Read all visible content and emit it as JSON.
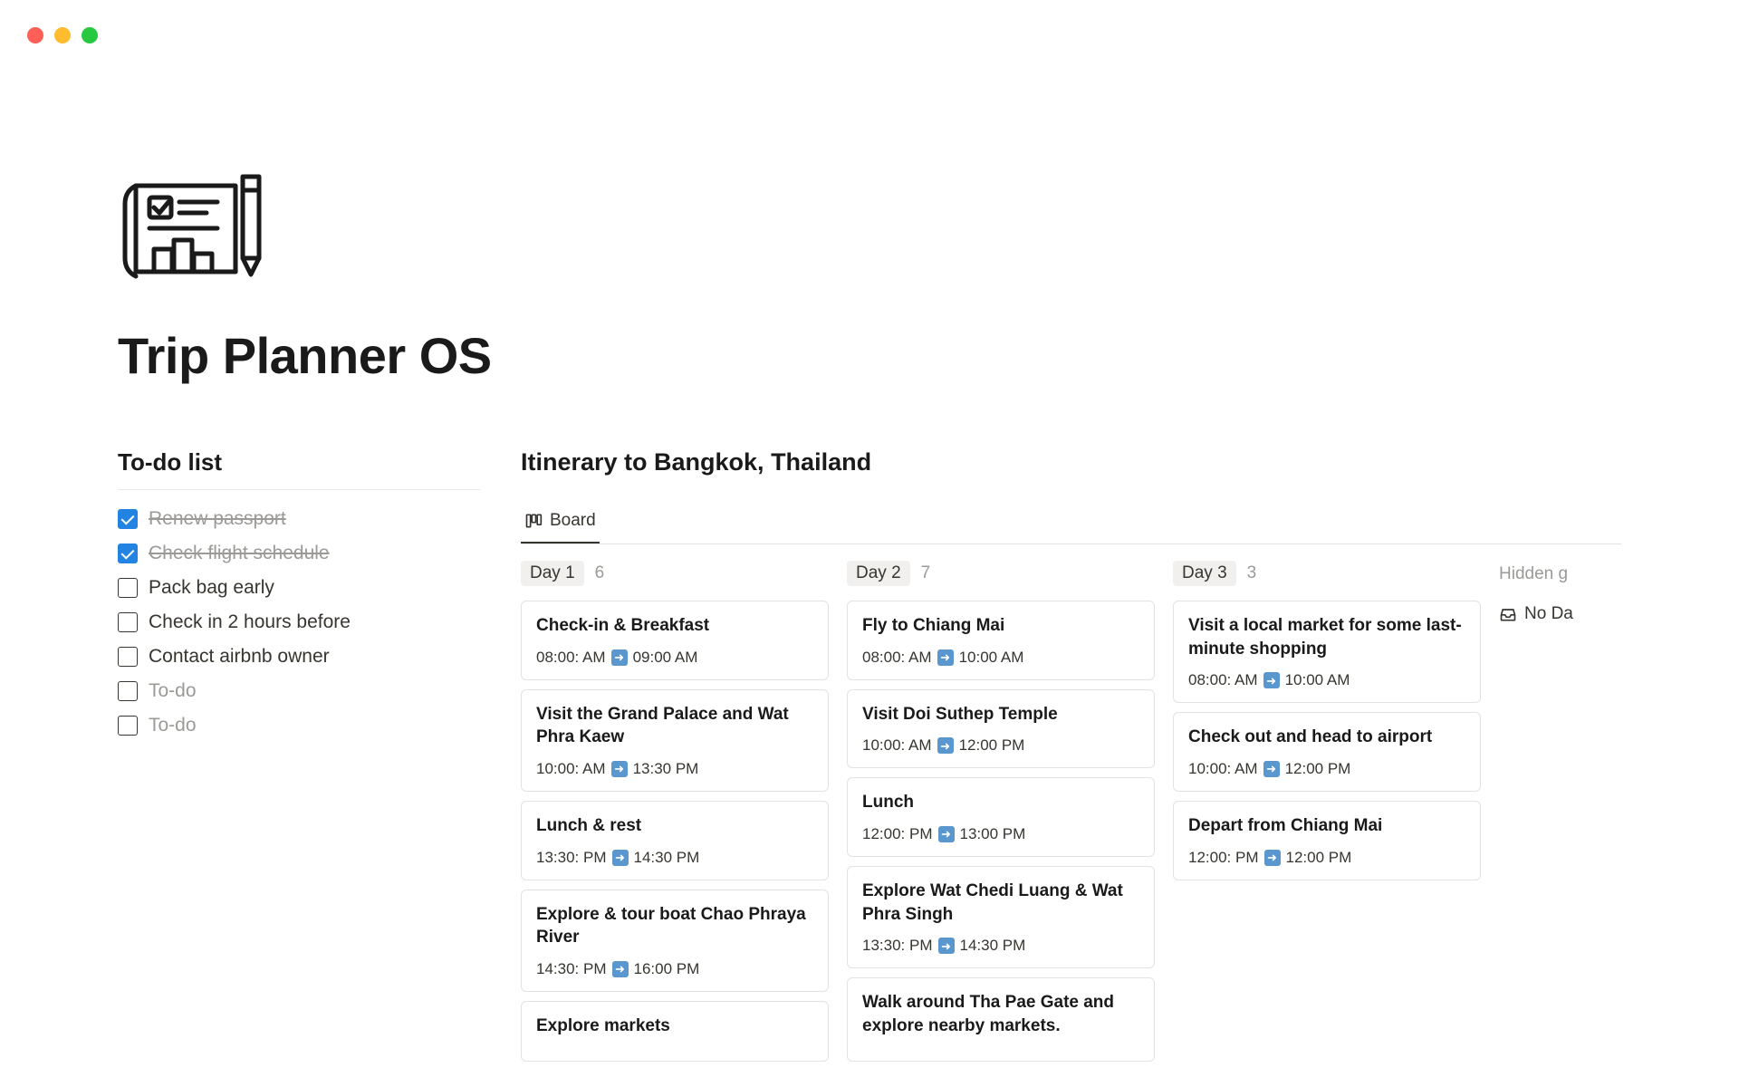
{
  "page": {
    "title": "Trip Planner OS"
  },
  "todo": {
    "heading": "To-do list",
    "items": [
      {
        "label": "Renew passport",
        "checked": true
      },
      {
        "label": "Check flight schedule",
        "checked": true
      },
      {
        "label": "Pack bag early",
        "checked": false
      },
      {
        "label": "Check in 2 hours before",
        "checked": false
      },
      {
        "label": "Contact airbnb owner",
        "checked": false
      },
      {
        "label": "To-do",
        "checked": false,
        "placeholder": true
      },
      {
        "label": "To-do",
        "checked": false,
        "placeholder": true
      }
    ]
  },
  "itinerary": {
    "heading": "Itinerary to Bangkok, Thailand",
    "tab_label": "Board",
    "hidden_groups_label": "Hidden g",
    "nodata_label": "No Da",
    "columns": [
      {
        "name": "Day 1",
        "count": "6",
        "cards": [
          {
            "title": "Check-in & Breakfast",
            "start": "08:00: AM",
            "end": "09:00 AM"
          },
          {
            "title": "Visit the Grand Palace and Wat Phra Kaew",
            "start": "10:00: AM",
            "end": "13:30 PM"
          },
          {
            "title": "Lunch & rest",
            "start": "13:30: PM",
            "end": "14:30 PM"
          },
          {
            "title": "Explore & tour boat Chao Phraya River",
            "start": "14:30: PM",
            "end": "16:00 PM"
          },
          {
            "title": "Explore markets",
            "start": "",
            "end": ""
          }
        ]
      },
      {
        "name": "Day 2",
        "count": "7",
        "cards": [
          {
            "title": "Fly to Chiang Mai",
            "start": "08:00: AM",
            "end": "10:00 AM"
          },
          {
            "title": "Visit Doi Suthep Temple",
            "start": "10:00: AM",
            "end": "12:00 PM"
          },
          {
            "title": "Lunch",
            "start": "12:00: PM",
            "end": "13:00 PM"
          },
          {
            "title": "Explore Wat Chedi Luang & Wat Phra Singh",
            "start": "13:30: PM",
            "end": "14:30 PM"
          },
          {
            "title": "Walk around Tha Pae Gate and explore nearby markets.",
            "start": "",
            "end": ""
          }
        ]
      },
      {
        "name": "Day 3",
        "count": "3",
        "cards": [
          {
            "title": "Visit a local market for some last-minute shopping",
            "start": "08:00: AM",
            "end": "10:00 AM"
          },
          {
            "title": "Check out and head to airport",
            "start": "10:00: AM",
            "end": "12:00 PM"
          },
          {
            "title": "Depart from Chiang Mai",
            "start": "12:00: PM",
            "end": "12:00 PM"
          }
        ]
      }
    ]
  }
}
